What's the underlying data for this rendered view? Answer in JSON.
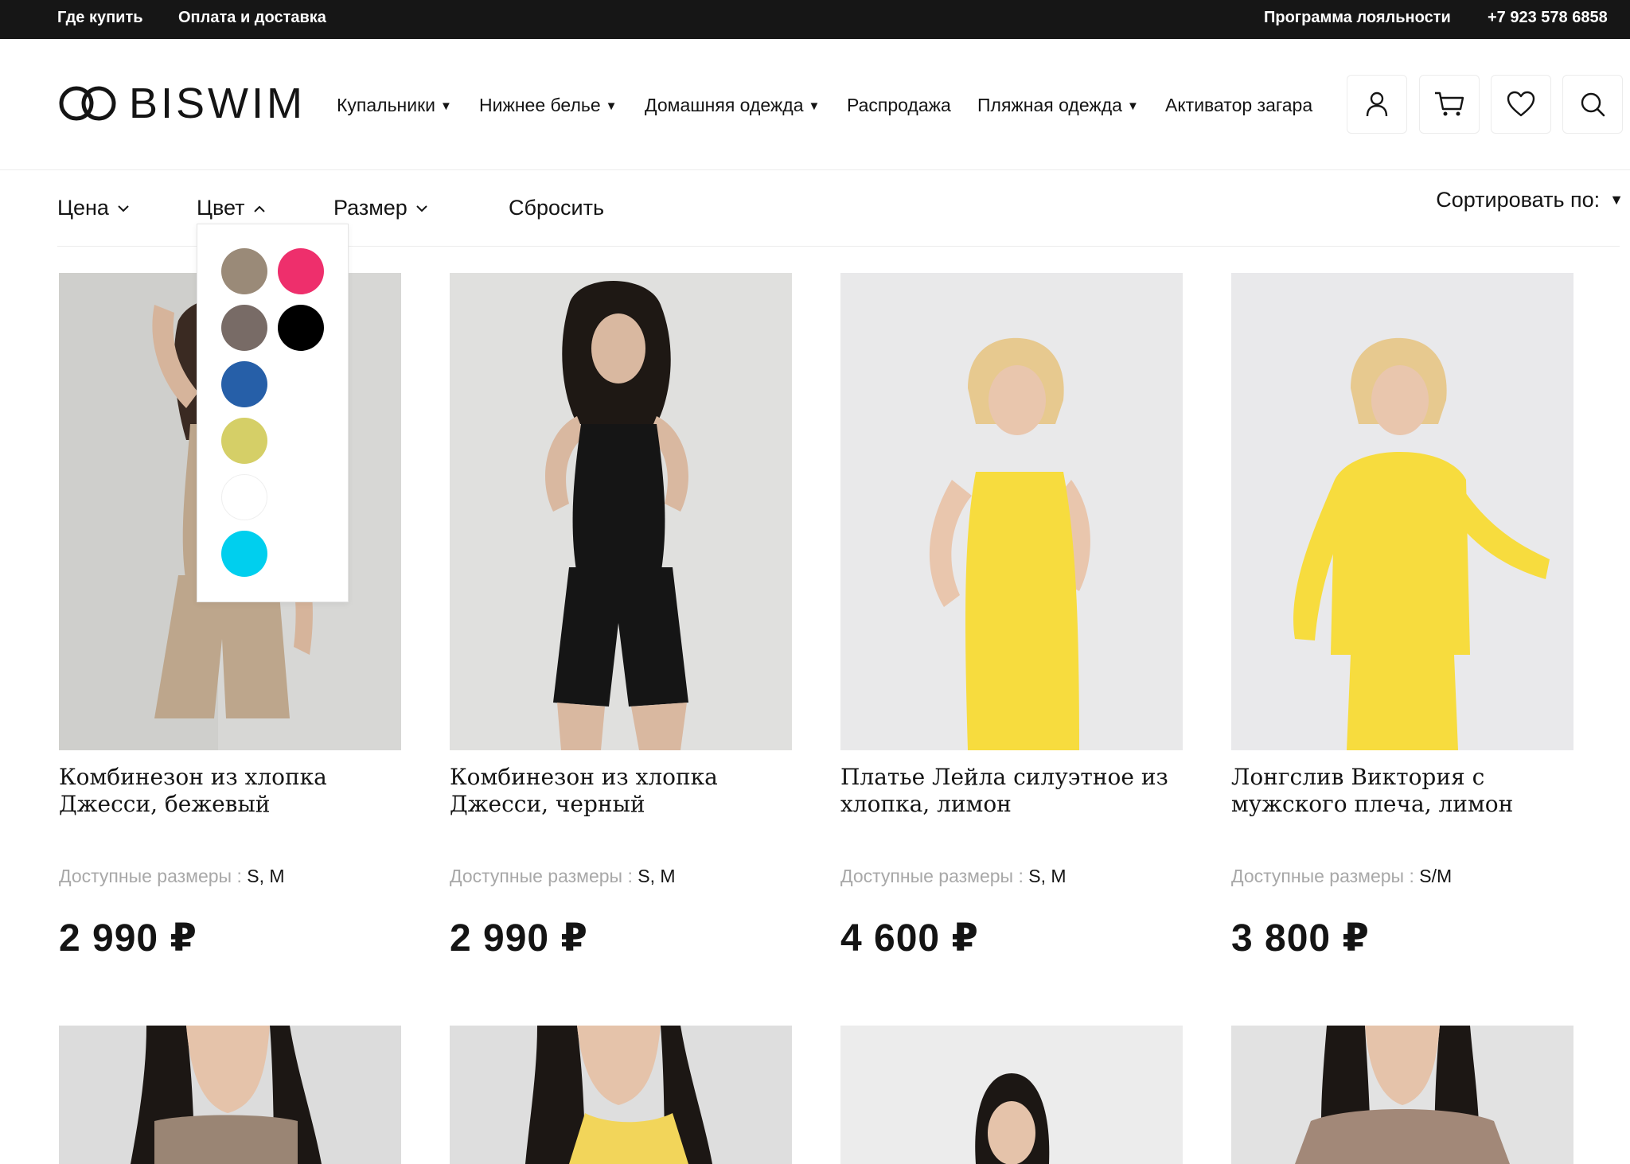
{
  "topbar": {
    "where_to_buy": "Где купить",
    "payment_delivery": "Оплата и доставка",
    "loyalty": "Программа лояльности",
    "phone": "+7 923 578 6858"
  },
  "header": {
    "logo_text": "BISWIM",
    "nav": [
      {
        "label": "Купальники",
        "has_dropdown": true
      },
      {
        "label": "Нижнее белье",
        "has_dropdown": true
      },
      {
        "label": "Домашняя одежда",
        "has_dropdown": true
      },
      {
        "label": "Распродажа",
        "has_dropdown": false
      },
      {
        "label": "Пляжная одежда",
        "has_dropdown": true
      },
      {
        "label": "Активатор загара",
        "has_dropdown": false
      }
    ],
    "icons": [
      "user-icon",
      "cart-icon",
      "heart-icon",
      "search-icon"
    ]
  },
  "filters": {
    "price": "Цена",
    "color": "Цвет",
    "size": "Размер",
    "reset": "Сбросить",
    "sort": "Сортировать по:"
  },
  "color_dropdown": {
    "open": true,
    "swatches": [
      {
        "name": "beige",
        "color": "#9a8a78"
      },
      {
        "name": "pink",
        "color": "#ee2f6c"
      },
      {
        "name": "mocha",
        "color": "#786b66"
      },
      {
        "name": "black",
        "color": "#000000"
      },
      {
        "name": "blue",
        "color": "#265fa8"
      },
      {
        "name": "lemon",
        "color": "#d5cf67"
      },
      {
        "name": "white",
        "color": "#ffffff"
      },
      {
        "name": "cyan",
        "color": "#00cfee"
      }
    ]
  },
  "products": [
    {
      "title": "Комбинезон из хлопка Джесси, бежевый",
      "sizes_label": "Доступные размеры : ",
      "sizes": "S, M",
      "price": "2 990 ₽",
      "garment_color": "#bda68c"
    },
    {
      "title": "Комбинезон из хлопка Джесси, черный",
      "sizes_label": "Доступные размеры : ",
      "sizes": "S, M",
      "price": "2 990 ₽",
      "garment_color": "#151515"
    },
    {
      "title": "Платье Лейла силуэтное из хлопка, лимон",
      "sizes_label": "Доступные размеры : ",
      "sizes": "S, M",
      "price": "4 600 ₽",
      "garment_color": "#f7dc3e"
    },
    {
      "title": "Лонгслив Виктория с мужского плеча, лимон",
      "sizes_label": "Доступные размеры : ",
      "sizes": "S/M",
      "price": "3 800 ₽",
      "garment_color": "#f7dc3e"
    }
  ],
  "next_row_garments": [
    "#9a8574",
    "#f2d55a",
    "#ececec",
    "#a28878"
  ]
}
